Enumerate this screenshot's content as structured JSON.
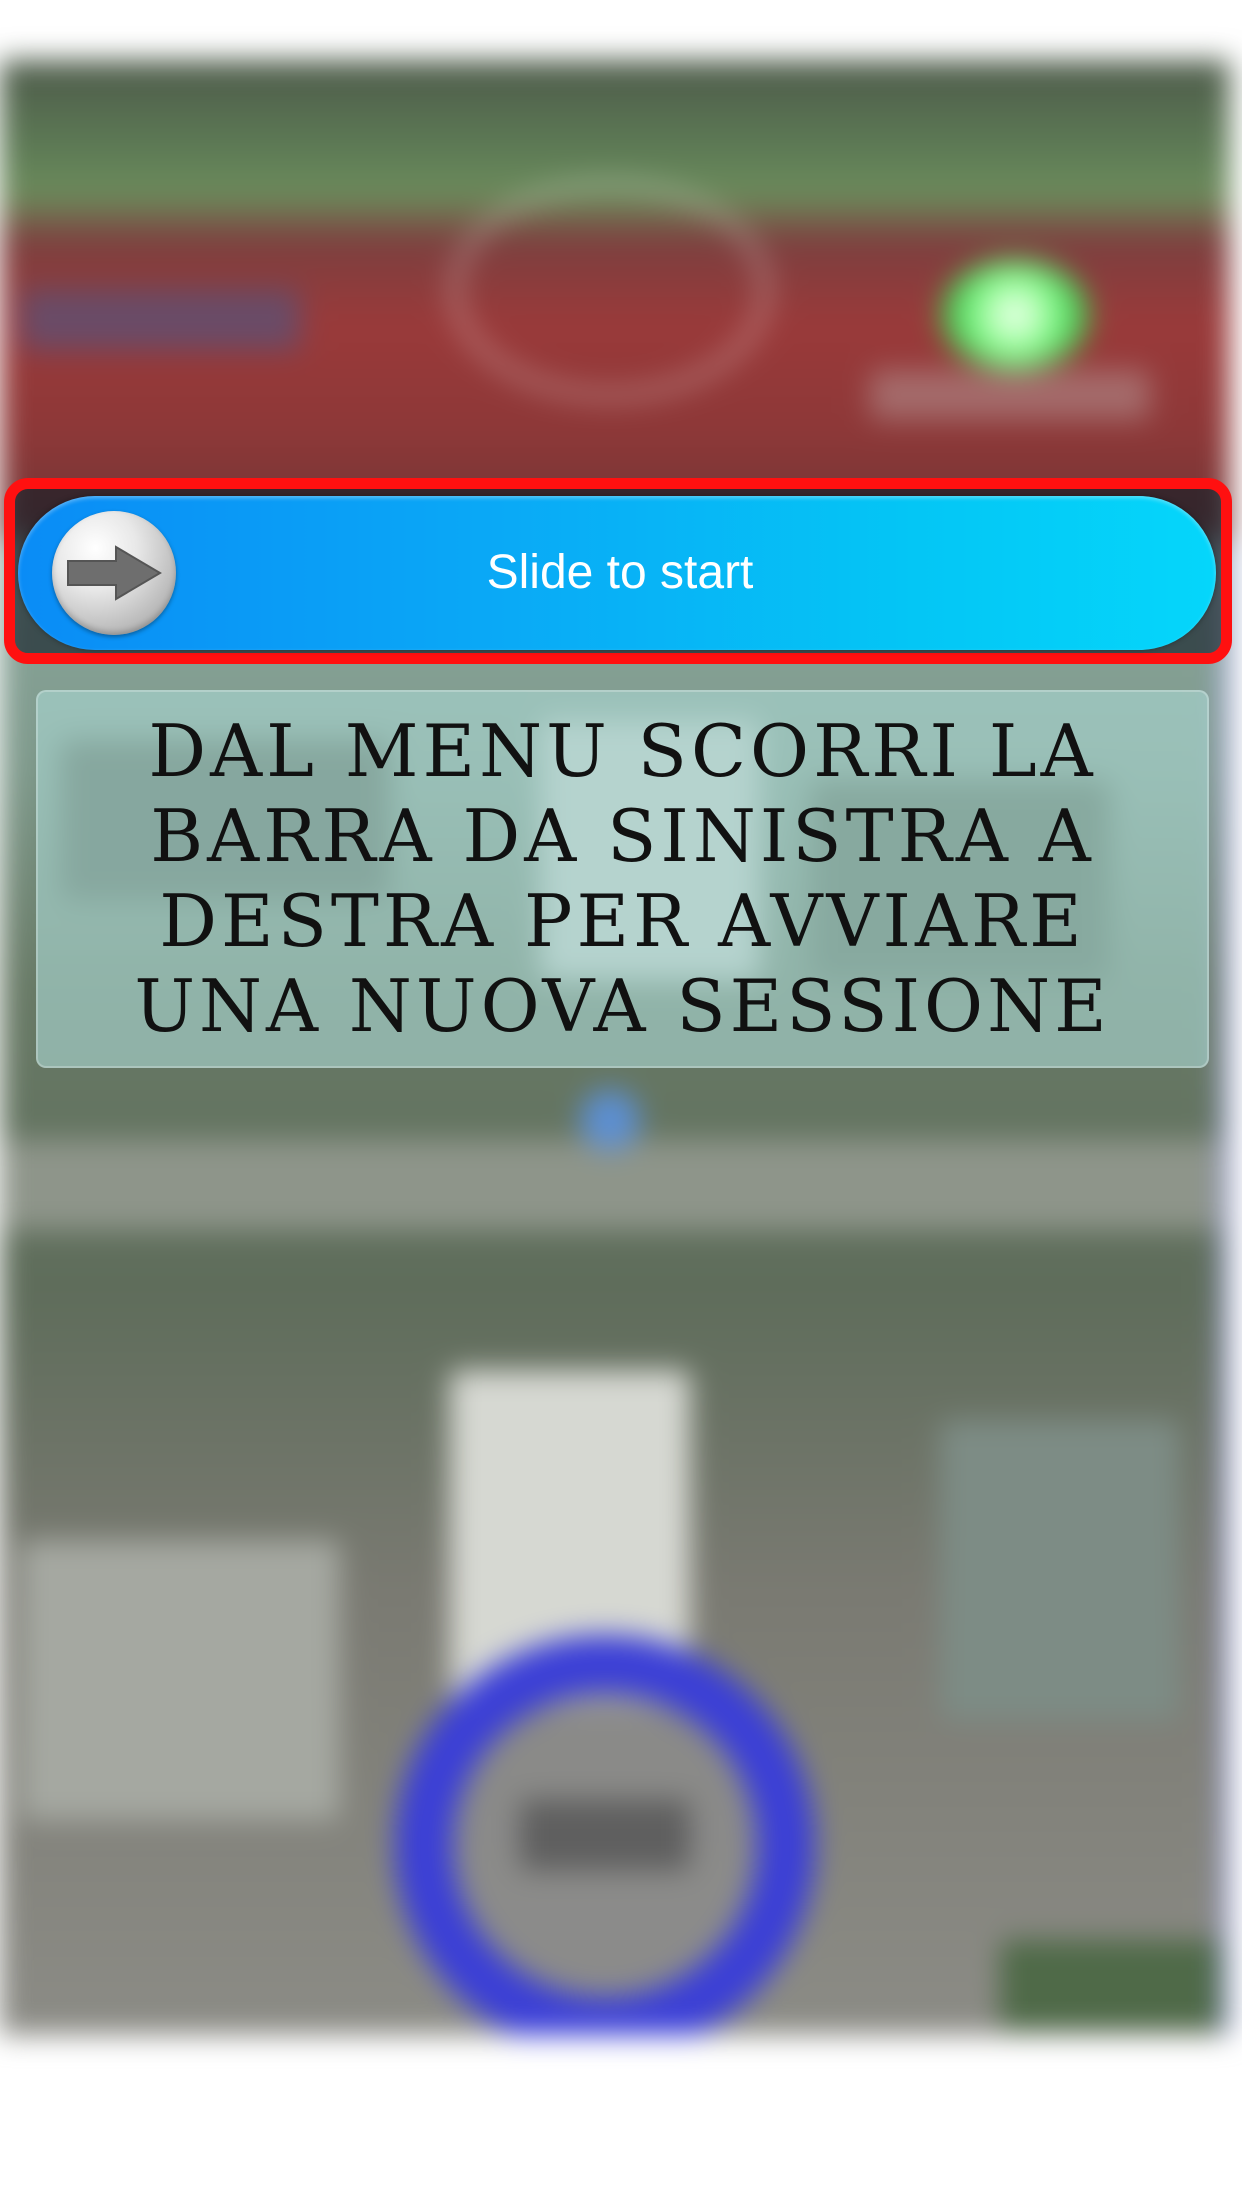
{
  "slider": {
    "label": "Slide to start",
    "knob_icon": "arrow-right-icon",
    "highlight_color": "#ff1010",
    "track_color_start": "#0a8cf6",
    "track_color_end": "#05d6fb"
  },
  "instruction": {
    "text": "DAL MENU SCORRI LA BARRA DA SINISTRA A DESTRA PER AVVIARE UNA NUOVA SESSIONE"
  },
  "colors": {
    "ring": "#3b3fd6",
    "location_dot": "#5c8fd2"
  }
}
